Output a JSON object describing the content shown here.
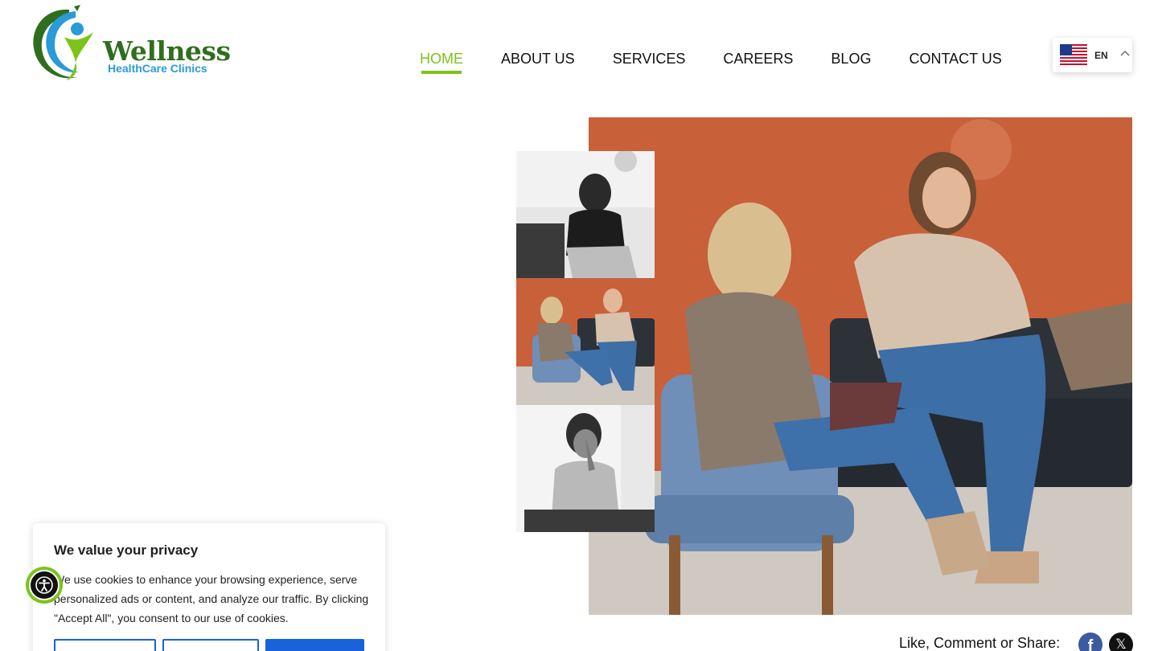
{
  "brand": {
    "logo_word": "Wellness",
    "logo_subtitle": "HealthCare Clinics",
    "colors": {
      "green": "#2f6e1e",
      "blue": "#2a9ad8",
      "accent": "#7dc31a"
    }
  },
  "nav": {
    "items": [
      {
        "label": "HOME",
        "active": true
      },
      {
        "label": "ABOUT US",
        "active": false
      },
      {
        "label": "SERVICES",
        "active": false
      },
      {
        "label": "CAREERS",
        "active": false
      },
      {
        "label": "BLOG",
        "active": false
      },
      {
        "label": "CONTACT US",
        "active": false
      }
    ]
  },
  "language": {
    "code": "EN",
    "flag_icon": "us-flag-icon",
    "chevron_icon": "chevron-up-icon"
  },
  "gallery": {
    "main_image": "therapy-session-photo",
    "thumbnails": [
      "woman-speaking-bw-photo",
      "therapy-session-thumbnail",
      "stressed-woman-bw-photo"
    ]
  },
  "share": {
    "label": "Like, Comment or Share:",
    "facebook_glyph": "f",
    "x_glyph": "𝕏"
  },
  "cookie_banner": {
    "title": "We value your privacy",
    "text": "We use cookies to enhance your browsing experience, serve personalized ads or content, and analyze our traffic. By clicking \"Accept All\", you consent to our use of cookies.",
    "accent": "#1863dc"
  },
  "accessibility": {
    "icon": "accessibility-icon"
  }
}
